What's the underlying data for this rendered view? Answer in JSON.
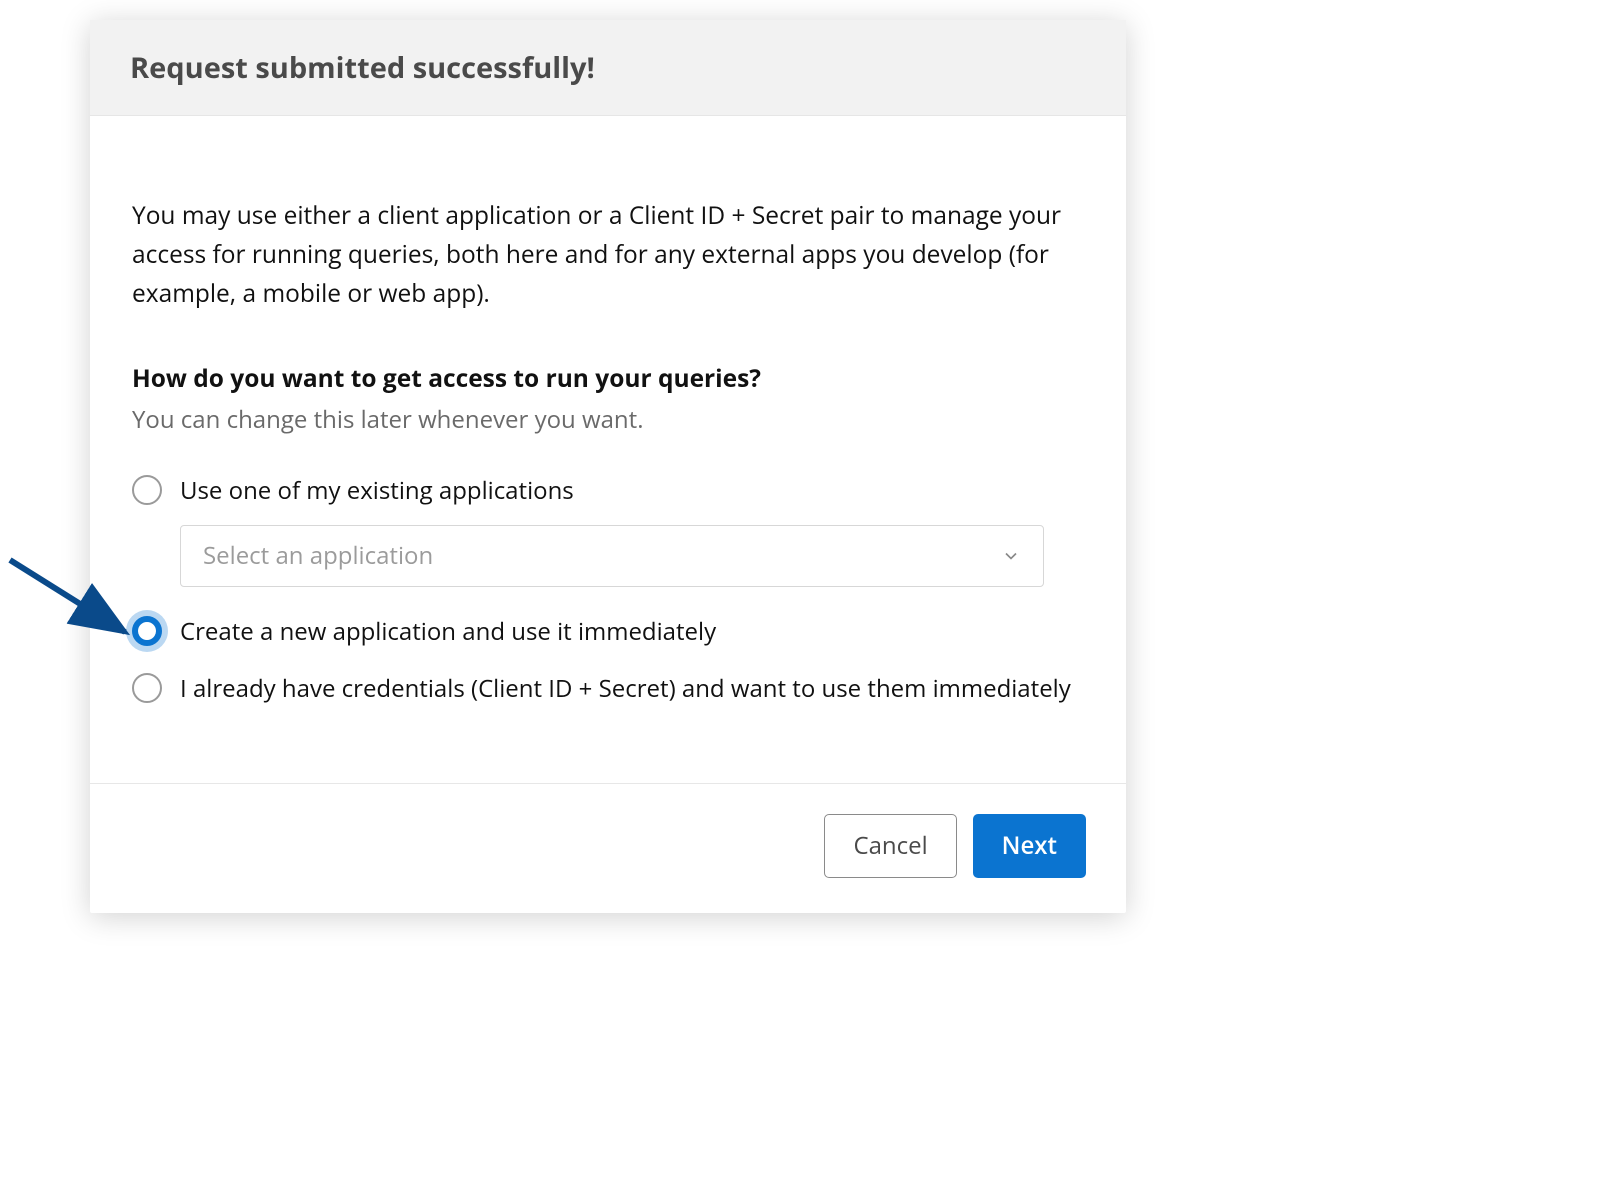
{
  "dialog": {
    "title": "Request submitted successfully!",
    "intro": "You may use either a client application or a Client ID + Secret pair to manage your access for running queries, both here and for any external apps you develop (for example, a mobile or web app).",
    "question": "How do you want to get access to run your queries?",
    "hint": "You can change this later whenever you want.",
    "options": [
      {
        "id": "existing",
        "label": "Use one of my existing applications",
        "selected": false
      },
      {
        "id": "create",
        "label": "Create a new application and use it immediately",
        "selected": true
      },
      {
        "id": "credentials",
        "label": "I already have credentials (Client ID + Secret) and want to use them immediately",
        "selected": false
      }
    ],
    "select": {
      "placeholder": "Select an application",
      "value": ""
    }
  },
  "footer": {
    "cancel_label": "Cancel",
    "next_label": "Next"
  },
  "colors": {
    "accent": "#0b74d0",
    "text": "#111111",
    "muted": "#6a6a6a",
    "header_bg": "#f2f2f2"
  }
}
